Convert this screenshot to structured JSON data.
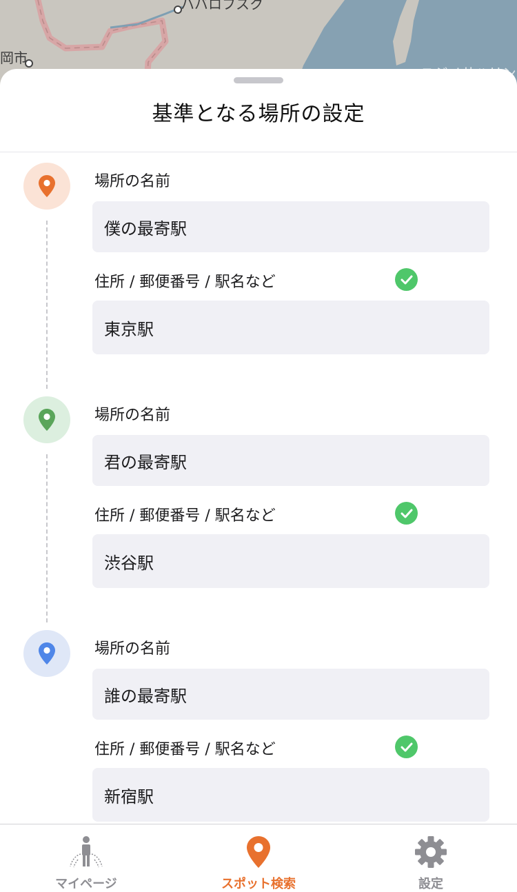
{
  "map": {
    "labels": [
      "岡市",
      "ハバロフスク",
      "ユジノサハリン"
    ]
  },
  "sheet": {
    "title": "基準となる場所の設定"
  },
  "locations": [
    {
      "name_label": "場所の名前",
      "name_value": "僕の最寄駅",
      "address_label": "住所 / 郵便番号 / 駅名など",
      "address_value": "東京駅",
      "pin_color": "#e8712e",
      "pin_bg": "#fbe3d6",
      "valid": true
    },
    {
      "name_label": "場所の名前",
      "name_value": "君の最寄駅",
      "address_label": "住所 / 郵便番号 / 駅名など",
      "address_value": "渋谷駅",
      "pin_color": "#5aa55a",
      "pin_bg": "#dcefdf",
      "valid": true
    },
    {
      "name_label": "場所の名前",
      "name_value": "誰の最寄駅",
      "address_label": "住所 / 郵便番号 / 駅名など",
      "address_value": "新宿駅",
      "pin_color": "#4f86e8",
      "pin_bg": "#dfe7f7",
      "valid": true
    }
  ],
  "tabbar": {
    "tabs": [
      {
        "label": "マイページ",
        "icon": "person-fountain-icon",
        "active": false
      },
      {
        "label": "スポット検索",
        "icon": "map-pin-icon",
        "active": true
      },
      {
        "label": "設定",
        "icon": "gear-icon",
        "active": false
      }
    ]
  },
  "colors": {
    "accent": "#e8712e",
    "check": "#4fc76a",
    "field_bg": "#f0f0f5",
    "inactive_tab": "#8e8e93"
  }
}
